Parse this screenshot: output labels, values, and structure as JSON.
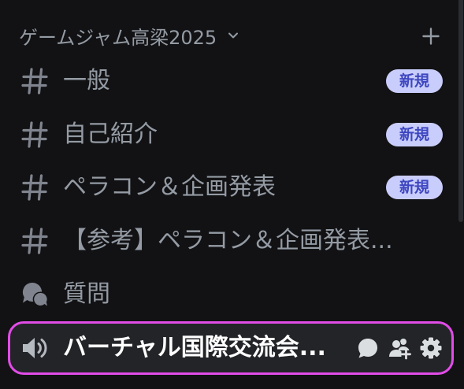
{
  "category": {
    "name": "ゲームジャム高梁2025",
    "collapse_icon": "chevron-down-icon",
    "add_icon": "plus-icon"
  },
  "channels": [
    {
      "icon": "hash-icon",
      "name": "一般",
      "badge": "新規"
    },
    {
      "icon": "hash-icon",
      "name": "自己紹介",
      "badge": "新規"
    },
    {
      "icon": "hash-icon",
      "name": "ペラコン＆企画発表",
      "badge": "新規"
    },
    {
      "icon": "hash-icon",
      "name": "【参考】ペラコン＆企画発表..."
    },
    {
      "icon": "forum-icon",
      "name": "質問"
    }
  ],
  "voice_channel": {
    "icon": "speaker-icon",
    "name": "バーチャル国際交流会...",
    "selected": true,
    "actions": [
      "chat-icon",
      "invite-icon",
      "gear-icon"
    ]
  },
  "colors": {
    "background": "#121214",
    "channel_text": "#949ba4",
    "icon": "#80848e",
    "badge_bg": "#c9cdfb",
    "badge_text": "#3e47c0",
    "selected_bg": "#232428",
    "selected_border": "#e24ce8",
    "selected_text": "#ffffff",
    "action_icon": "#dbdee1",
    "scrollbar": "#2b2d31"
  }
}
